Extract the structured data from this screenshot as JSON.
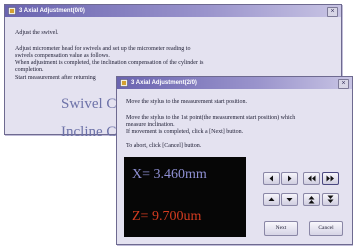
{
  "window1": {
    "title": "3 Axial Adjustment(0/0)",
    "close_label": "×",
    "lines": [
      "Adjust the swivel.",
      "Adjust micrometer head for swivels and set up the micrometer reading to",
      "swivels compensation value as follows.",
      "When adjustment is completed, the inclination compensation of the cylinder is",
      "completion.",
      "Start measurement after returning"
    ],
    "big_texts": [
      "Swivel C",
      "Incline C"
    ]
  },
  "window2": {
    "title": "3 Axial Adjustment(2/0)",
    "close_label": "×",
    "lines": [
      "Move the stylus to the measurement start position.",
      "Move the stylus to the 1st point(the measurement start position) which",
      "measure inclination.",
      "If movement is completed, click a [Next] button.",
      "To abort, click [Cancel] button."
    ],
    "readout": {
      "x": "X= 3.460mm",
      "z": "Z= 9.700um"
    },
    "buttons": {
      "next": "Next",
      "cancel": "Cancel"
    }
  }
}
